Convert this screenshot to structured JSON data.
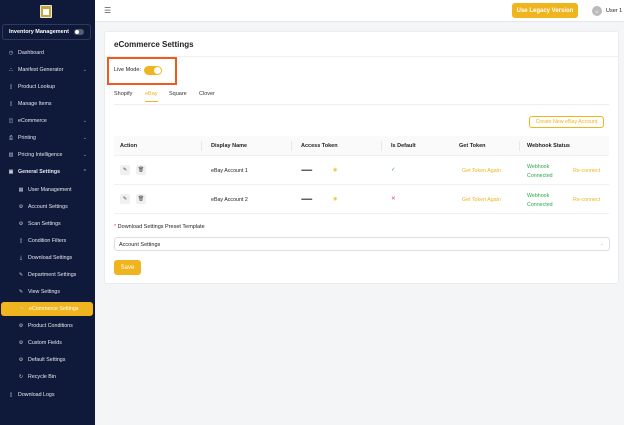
{
  "sidebar": {
    "toggle_label": "Inventory Management",
    "inventory_toggle_on": false,
    "items": [
      {
        "label": "Dashboard",
        "icon": "dashboard-icon"
      },
      {
        "label": "Manifest Generator",
        "icon": "sitemap-icon",
        "expandable": true
      },
      {
        "label": "Product Lookup",
        "icon": "file-icon"
      },
      {
        "label": "Manage Items",
        "icon": "file-icon"
      },
      {
        "label": "eCommerce",
        "icon": "bag-icon",
        "expandable": true
      },
      {
        "label": "Printing",
        "icon": "printer-icon",
        "expandable": true
      },
      {
        "label": "Pricing Intelligence",
        "icon": "chart-icon",
        "expandable": true
      },
      {
        "label": "General Settings",
        "icon": "settings-icon",
        "expanded": true
      }
    ],
    "sub_items": [
      {
        "label": "User Management",
        "icon": "table-icon"
      },
      {
        "label": "Account Settings",
        "icon": "gear-icon"
      },
      {
        "label": "Scan Settings",
        "icon": "gear-icon"
      },
      {
        "label": "Condition Filters",
        "icon": "file-icon"
      },
      {
        "label": "Download Settings",
        "icon": "download-icon"
      },
      {
        "label": "Department Settings",
        "icon": "edit-icon"
      },
      {
        "label": "View Settings",
        "icon": "edit-icon"
      },
      {
        "label": "eCommerce Settings",
        "icon": "edit-icon",
        "active": true
      },
      {
        "label": "Product Conditions",
        "icon": "gear-icon"
      },
      {
        "label": "Custom Fields",
        "icon": "gear-icon"
      },
      {
        "label": "Default Settings",
        "icon": "gear-icon"
      },
      {
        "label": "Recycle Bin",
        "icon": "recycle-icon"
      }
    ],
    "bottom_item": {
      "label": "Download Logs",
      "icon": "file-icon"
    }
  },
  "header": {
    "legacy_button": "Use Legacy Version",
    "avatar_initial": "U",
    "user_name": "User 1"
  },
  "page": {
    "title": "eCommerce Settings",
    "live_mode_label": "Live Mode:",
    "live_mode_on": true,
    "tabs": [
      {
        "label": "Shopify"
      },
      {
        "label": "eBay",
        "active": true
      },
      {
        "label": "Square"
      },
      {
        "label": "Clover"
      }
    ],
    "create_button": "Create New eBay Account",
    "table": {
      "headers": [
        "Action",
        "Display Name",
        "Access Token",
        "Is Default",
        "Get Token",
        "Webhook Status"
      ],
      "rows": [
        {
          "display_name": "eBay Account 1",
          "access_token": "••••••••••••••",
          "is_default": true,
          "get_token": "Get Token Again",
          "webhook_status": "Webhook Connected",
          "reconnect": "Re-connect"
        },
        {
          "display_name": "eBay Account 2",
          "access_token": "••••••••••••••",
          "is_default": false,
          "get_token": "Get Token Again",
          "webhook_status": "Webhook Connected",
          "reconnect": "Re-connect"
        }
      ]
    },
    "preset_label": "Download Settings Preset Template",
    "preset_value": "Account Settings",
    "save_button": "Save"
  },
  "colors": {
    "accent": "#f0b51e",
    "sidebar": "#0f1a3a",
    "highlight_border": "#f05a1e",
    "success": "#2aa84a",
    "error": "#e5484d"
  }
}
